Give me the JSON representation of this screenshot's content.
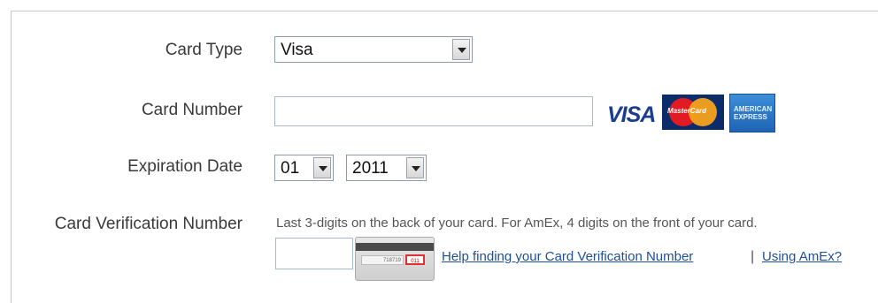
{
  "form": {
    "card_type": {
      "label": "Card Type",
      "selected": "Visa"
    },
    "card_number": {
      "label": "Card Number",
      "value": "",
      "logos": [
        "visa-logo",
        "mastercard-logo",
        "amex-logo"
      ],
      "visa_text": "VISA",
      "mastercard_text": "MasterCard",
      "amex_text": "AMERICAN EXPRESS"
    },
    "expiration": {
      "label": "Expiration Date",
      "month": "01",
      "year": "2011"
    },
    "cvv": {
      "label": "Card Verification Number",
      "hint": "Last 3-digits on the back of your card. For AmEx, 4 digits on the front of your card.",
      "value": "",
      "card_digits": "718719",
      "card_cvv": "011",
      "help_link": "Help finding your Card Verification Number",
      "separator": "|",
      "amex_link": "Using AmEx?"
    }
  },
  "colors": {
    "link": "#1d4f9c",
    "visa": "#1a3d8f",
    "mastercard_red": "#e21b23",
    "mastercard_orange": "#f6a21b",
    "amex_blue": "#1e63b5"
  }
}
